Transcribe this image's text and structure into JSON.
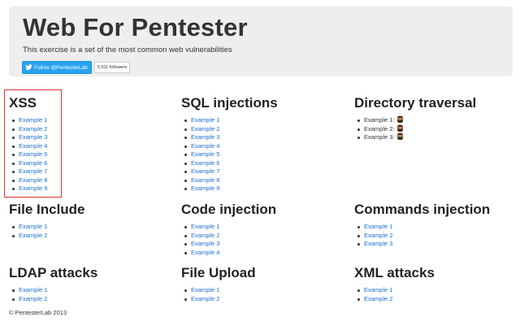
{
  "header": {
    "title": "Web For Pentester",
    "subtitle": "This exercise is a set of the most common web vulnerabilities",
    "follow_label": "Follow @PentesterLab",
    "followers_label": "5,911 followers"
  },
  "sections": [
    {
      "title": "XSS",
      "items": [
        "Example 1",
        "Example 2",
        "Example 3",
        "Example 4",
        "Example 5",
        "Example 6",
        "Example 7",
        "Example 8",
        "Example 9"
      ]
    },
    {
      "title": "SQL injections",
      "items": [
        "Example 1",
        "Example 2",
        "Example 3",
        "Example 4",
        "Example 5",
        "Example 6",
        "Example 7",
        "Example 8",
        "Example 9"
      ]
    },
    {
      "title": "Directory traversal",
      "items": [
        "Example 1:",
        "Example 2:",
        "Example 3:"
      ]
    },
    {
      "title": "File Include",
      "items": [
        "Example 1",
        "Example 2"
      ]
    },
    {
      "title": "Code injection",
      "items": [
        "Example 1",
        "Example 2",
        "Example 3",
        "Example 4"
      ]
    },
    {
      "title": "Commands injection",
      "items": [
        "Example 1",
        "Example 2",
        "Example 3"
      ]
    },
    {
      "title": "LDAP attacks",
      "items": [
        "Example 1",
        "Example 2"
      ]
    },
    {
      "title": "File Upload",
      "items": [
        "Example 1",
        "Example 2"
      ]
    },
    {
      "title": "XML attacks",
      "items": [
        "Example 1",
        "Example 2"
      ]
    }
  ],
  "footer": {
    "copyright": "© PentesterLab 2013"
  },
  "colors": {
    "link": "#1a6fd1",
    "hero_bg": "#eeeeee",
    "twitter": "#2aa3ef",
    "highlight": "#e03131"
  },
  "icons": {
    "twitter": "twitter-bird-icon",
    "ninja": "ninja-icon"
  }
}
